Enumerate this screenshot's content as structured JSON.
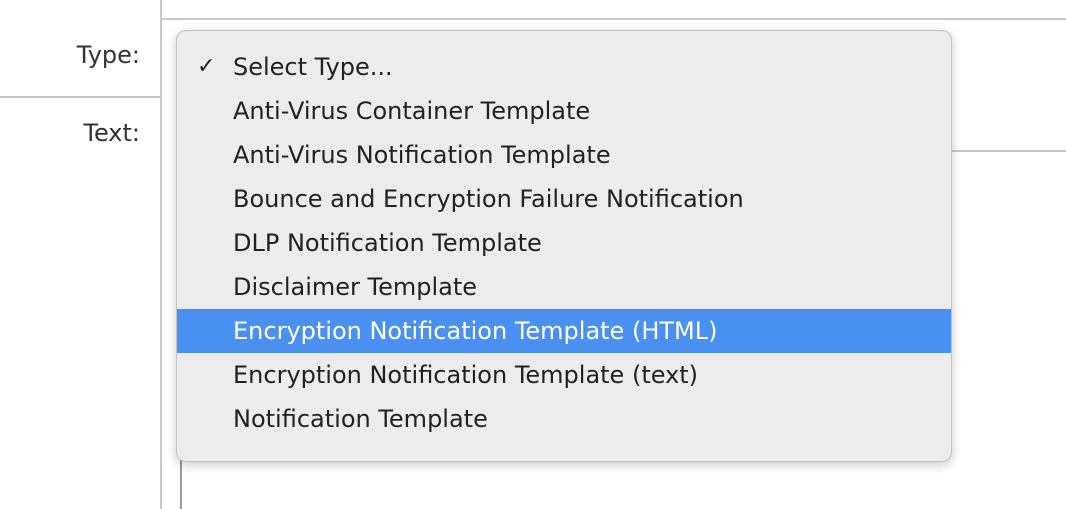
{
  "form": {
    "type_label": "Type:",
    "text_label": "Text:"
  },
  "dropdown": {
    "selected": "Select Type...",
    "highlighted": "Encryption Notification Template (HTML)",
    "highlight_color": "#4a90f0",
    "check_icon": "✓",
    "options": [
      "Select Type...",
      "Anti-Virus Container Template",
      "Anti-Virus Notification Template",
      "Bounce and Encryption Failure Notification",
      "DLP Notification Template",
      "Disclaimer Template",
      "Encryption Notification Template (HTML)",
      "Encryption Notification Template (text)",
      "Notification Template"
    ]
  }
}
